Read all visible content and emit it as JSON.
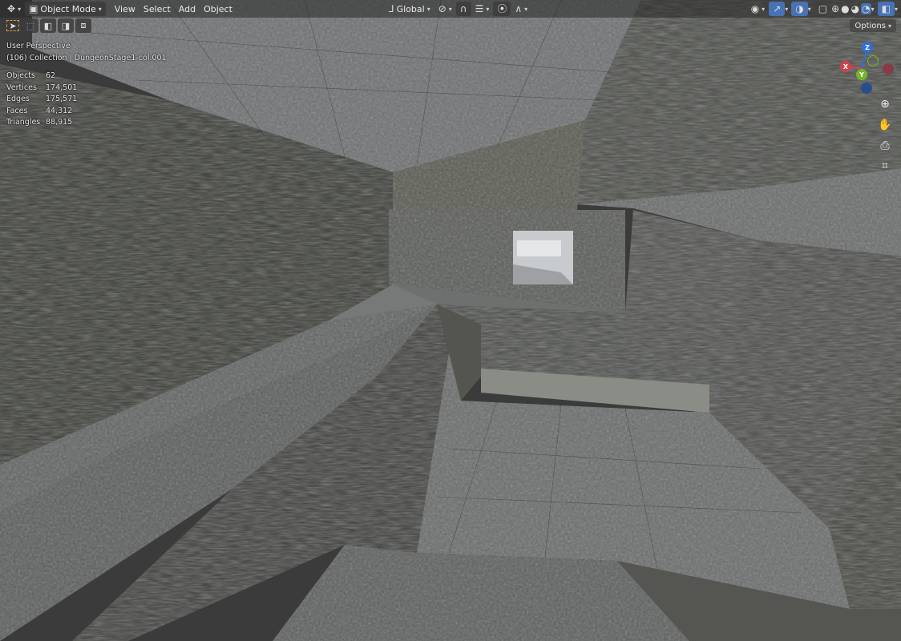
{
  "header": {
    "mode_label": "Object Mode",
    "menus": [
      "View",
      "Select",
      "Add",
      "Object"
    ],
    "orientation_label": "Global"
  },
  "options_label": "Options",
  "overlay": {
    "perspective": "User Perspective",
    "collection": "(106) Collection | DungeonStage1-col.001"
  },
  "stats": [
    {
      "label": "Objects",
      "value": "62"
    },
    {
      "label": "Vertices",
      "value": "174,501"
    },
    {
      "label": "Edges",
      "value": "175,571"
    },
    {
      "label": "Faces",
      "value": "44,312"
    },
    {
      "label": "Triangles",
      "value": "88,915"
    }
  ],
  "gizmo": {
    "z": "Z",
    "x": "X",
    "y": "Y",
    "colors": {
      "z": "#2f70d8",
      "x": "#d3404f",
      "y": "#76b52a",
      "neg": "#8a3a44"
    }
  },
  "colors": {
    "accent": "#4772b3"
  }
}
